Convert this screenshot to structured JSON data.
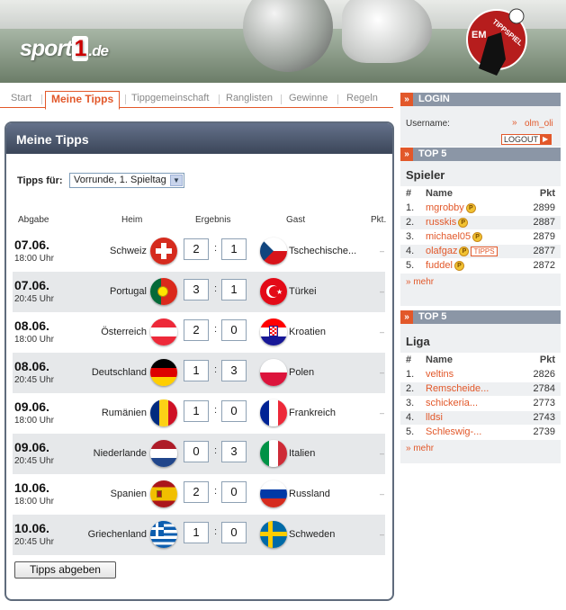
{
  "header": {
    "logo": {
      "brand": "sport",
      "one": "1",
      "tld": ".de"
    },
    "em_logo_text": "TIPPSPIEL",
    "em_logo_em": "EM"
  },
  "nav": [
    {
      "label": "Start",
      "active": false
    },
    {
      "label": "Meine Tipps",
      "active": true
    },
    {
      "label": "Tippgemeinschaft",
      "active": false
    },
    {
      "label": "Ranglisten",
      "active": false
    },
    {
      "label": "Gewinne",
      "active": false
    },
    {
      "label": "Regeln",
      "active": false
    }
  ],
  "panel": {
    "title": "Meine Tipps",
    "filter_label": "Tipps für:",
    "filter_value": "Vorrunde, 1. Spieltag",
    "columns": {
      "abgabe": "Abgabe",
      "heim": "Heim",
      "ergebnis": "Ergebnis",
      "gast": "Gast",
      "pkt": "Pkt."
    },
    "matches": [
      {
        "date": "07.06.",
        "time": "18:00 Uhr",
        "home": "Schweiz",
        "home_flag": "sui",
        "h": "2",
        "a": "1",
        "away": "Tschechische...",
        "away_flag": "cze",
        "pkt": "–"
      },
      {
        "date": "07.06.",
        "time": "20:45 Uhr",
        "home": "Portugal",
        "home_flag": "por",
        "h": "3",
        "a": "1",
        "away": "Türkei",
        "away_flag": "tur",
        "pkt": "–"
      },
      {
        "date": "08.06.",
        "time": "18:00 Uhr",
        "home": "Österreich",
        "home_flag": "aut",
        "h": "2",
        "a": "0",
        "away": "Kroatien",
        "away_flag": "cro",
        "pkt": "–"
      },
      {
        "date": "08.06.",
        "time": "20:45 Uhr",
        "home": "Deutschland",
        "home_flag": "ger",
        "h": "1",
        "a": "3",
        "away": "Polen",
        "away_flag": "pol",
        "pkt": "–"
      },
      {
        "date": "09.06.",
        "time": "18:00 Uhr",
        "home": "Rumänien",
        "home_flag": "rou",
        "h": "1",
        "a": "0",
        "away": "Frankreich",
        "away_flag": "fra",
        "pkt": "–"
      },
      {
        "date": "09.06.",
        "time": "20:45 Uhr",
        "home": "Niederlande",
        "home_flag": "ned",
        "h": "0",
        "a": "3",
        "away": "Italien",
        "away_flag": "ita",
        "pkt": "–"
      },
      {
        "date": "10.06.",
        "time": "18:00 Uhr",
        "home": "Spanien",
        "home_flag": "esp",
        "h": "2",
        "a": "0",
        "away": "Russland",
        "away_flag": "rus",
        "pkt": "–"
      },
      {
        "date": "10.06.",
        "time": "20:45 Uhr",
        "home": "Griechenland",
        "home_flag": "gre",
        "h": "1",
        "a": "0",
        "away": "Schweden",
        "away_flag": "swe",
        "pkt": "–"
      }
    ],
    "submit_label": "Tipps abgeben"
  },
  "login": {
    "heading": "LOGIN",
    "username_label": "Username:",
    "username": "olm_oli",
    "logout_label": "LOGOUT"
  },
  "top_spieler": {
    "heading": "TOP 5",
    "title": "Spieler",
    "cols": {
      "rank": "#",
      "name": "Name",
      "pkt": "Pkt"
    },
    "rows": [
      {
        "rank": "1.",
        "name": "mgrobby",
        "pkt": "2899",
        "tipps": false
      },
      {
        "rank": "2.",
        "name": "russkis",
        "pkt": "2887",
        "tipps": false
      },
      {
        "rank": "3.",
        "name": "michael05",
        "pkt": "2879",
        "tipps": false
      },
      {
        "rank": "4.",
        "name": "olafgaz",
        "pkt": "2877",
        "tipps": true
      },
      {
        "rank": "5.",
        "name": "fuddel",
        "pkt": "2872",
        "tipps": false
      }
    ],
    "tipps_label": "TIPPS",
    "badge": "P",
    "mehr": "mehr"
  },
  "top_liga": {
    "heading": "TOP 5",
    "title": "Liga",
    "cols": {
      "rank": "#",
      "name": "Name",
      "pkt": "Pkt"
    },
    "rows": [
      {
        "rank": "1.",
        "name": "veltins",
        "pkt": "2826"
      },
      {
        "rank": "2.",
        "name": "Remscheide...",
        "pkt": "2784"
      },
      {
        "rank": "3.",
        "name": "schickeria...",
        "pkt": "2773"
      },
      {
        "rank": "4.",
        "name": "lldsi",
        "pkt": "2743"
      },
      {
        "rank": "5.",
        "name": "Schleswig-...",
        "pkt": "2739"
      }
    ],
    "mehr": "mehr"
  },
  "colors": {
    "accent": "#e2582a",
    "panel_header": "#4a5568",
    "row_alt": "#e6e8ea"
  }
}
